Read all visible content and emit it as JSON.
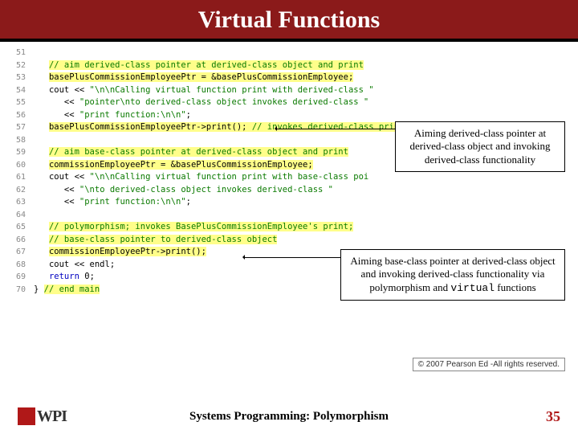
{
  "header": {
    "title": "Virtual Functions"
  },
  "code": {
    "lines": [
      {
        "n": "51",
        "segs": []
      },
      {
        "n": "52",
        "segs": [
          {
            "t": "   ",
            "c": ""
          },
          {
            "t": "// aim derived-class pointer at derived-class object and print",
            "c": "cmt"
          }
        ]
      },
      {
        "n": "53",
        "segs": [
          {
            "t": "   ",
            "c": ""
          },
          {
            "t": "basePlusCommissionEmployeePtr = &basePlusCommissionEmployee;",
            "c": "code-hl"
          }
        ]
      },
      {
        "n": "54",
        "segs": [
          {
            "t": "   cout << ",
            "c": ""
          },
          {
            "t": "\"\\n\\nCalling virtual function print with derived-class \"",
            "c": "str"
          }
        ]
      },
      {
        "n": "55",
        "segs": [
          {
            "t": "      << ",
            "c": ""
          },
          {
            "t": "\"pointer\\nto derived-class object invokes derived-class \"",
            "c": "str"
          }
        ]
      },
      {
        "n": "56",
        "segs": [
          {
            "t": "      << ",
            "c": ""
          },
          {
            "t": "\"print function:\\n\\n\"",
            "c": "str"
          },
          {
            "t": ";",
            "c": ""
          }
        ]
      },
      {
        "n": "57",
        "segs": [
          {
            "t": "   ",
            "c": ""
          },
          {
            "t": "basePlusCommissionEmployeePtr->print(); ",
            "c": "code-hl"
          },
          {
            "t": "// invokes derived-class print",
            "c": "cmt"
          }
        ]
      },
      {
        "n": "58",
        "segs": []
      },
      {
        "n": "59",
        "segs": [
          {
            "t": "   ",
            "c": ""
          },
          {
            "t": "// aim base-class pointer at derived-class object and print",
            "c": "cmt"
          }
        ]
      },
      {
        "n": "60",
        "segs": [
          {
            "t": "   ",
            "c": ""
          },
          {
            "t": "commissionEmployeePtr = &basePlusCommissionEmployee;",
            "c": "code-hl"
          }
        ]
      },
      {
        "n": "61",
        "segs": [
          {
            "t": "   cout << ",
            "c": ""
          },
          {
            "t": "\"\\n\\nCalling virtual function print with base-class poi",
            "c": "str"
          }
        ]
      },
      {
        "n": "62",
        "segs": [
          {
            "t": "      << ",
            "c": ""
          },
          {
            "t": "\"\\nto derived-class object invokes derived-class \"",
            "c": "str"
          }
        ]
      },
      {
        "n": "63",
        "segs": [
          {
            "t": "      << ",
            "c": ""
          },
          {
            "t": "\"print function:\\n\\n\"",
            "c": "str"
          },
          {
            "t": ";",
            "c": ""
          }
        ]
      },
      {
        "n": "64",
        "segs": []
      },
      {
        "n": "65",
        "segs": [
          {
            "t": "   ",
            "c": ""
          },
          {
            "t": "// polymorphism; invokes BasePlusCommissionEmployee's print;",
            "c": "cmt"
          }
        ]
      },
      {
        "n": "66",
        "segs": [
          {
            "t": "   ",
            "c": ""
          },
          {
            "t": "// base-class pointer to derived-class object",
            "c": "cmt"
          }
        ]
      },
      {
        "n": "67",
        "segs": [
          {
            "t": "   ",
            "c": ""
          },
          {
            "t": "commissionEmployeePtr->print();",
            "c": "code-hl"
          }
        ]
      },
      {
        "n": "68",
        "segs": [
          {
            "t": "   cout << endl;",
            "c": ""
          }
        ]
      },
      {
        "n": "69",
        "segs": [
          {
            "t": "   ",
            "c": ""
          },
          {
            "t": "return",
            "c": "kw"
          },
          {
            "t": " ",
            "c": ""
          },
          {
            "t": "0",
            "c": "num"
          },
          {
            "t": ";",
            "c": ""
          }
        ]
      },
      {
        "n": "70",
        "segs": [
          {
            "t": "} ",
            "c": ""
          },
          {
            "t": "// end main",
            "c": "cmt"
          }
        ]
      }
    ]
  },
  "callouts": {
    "c1": "Aiming derived-class pointer at derived-class object and invoking derived-class functionality",
    "c2_pre": "Aiming base-class pointer at derived-class object and invoking derived-class functionality via polymorphism and ",
    "c2_code": "virtual",
    "c2_post": " functions"
  },
  "copyright": "© 2007 Pearson Ed -All rights reserved.",
  "footer": {
    "logo_text": "WPI",
    "title": "Systems Programming: Polymorphism",
    "page": "35"
  }
}
